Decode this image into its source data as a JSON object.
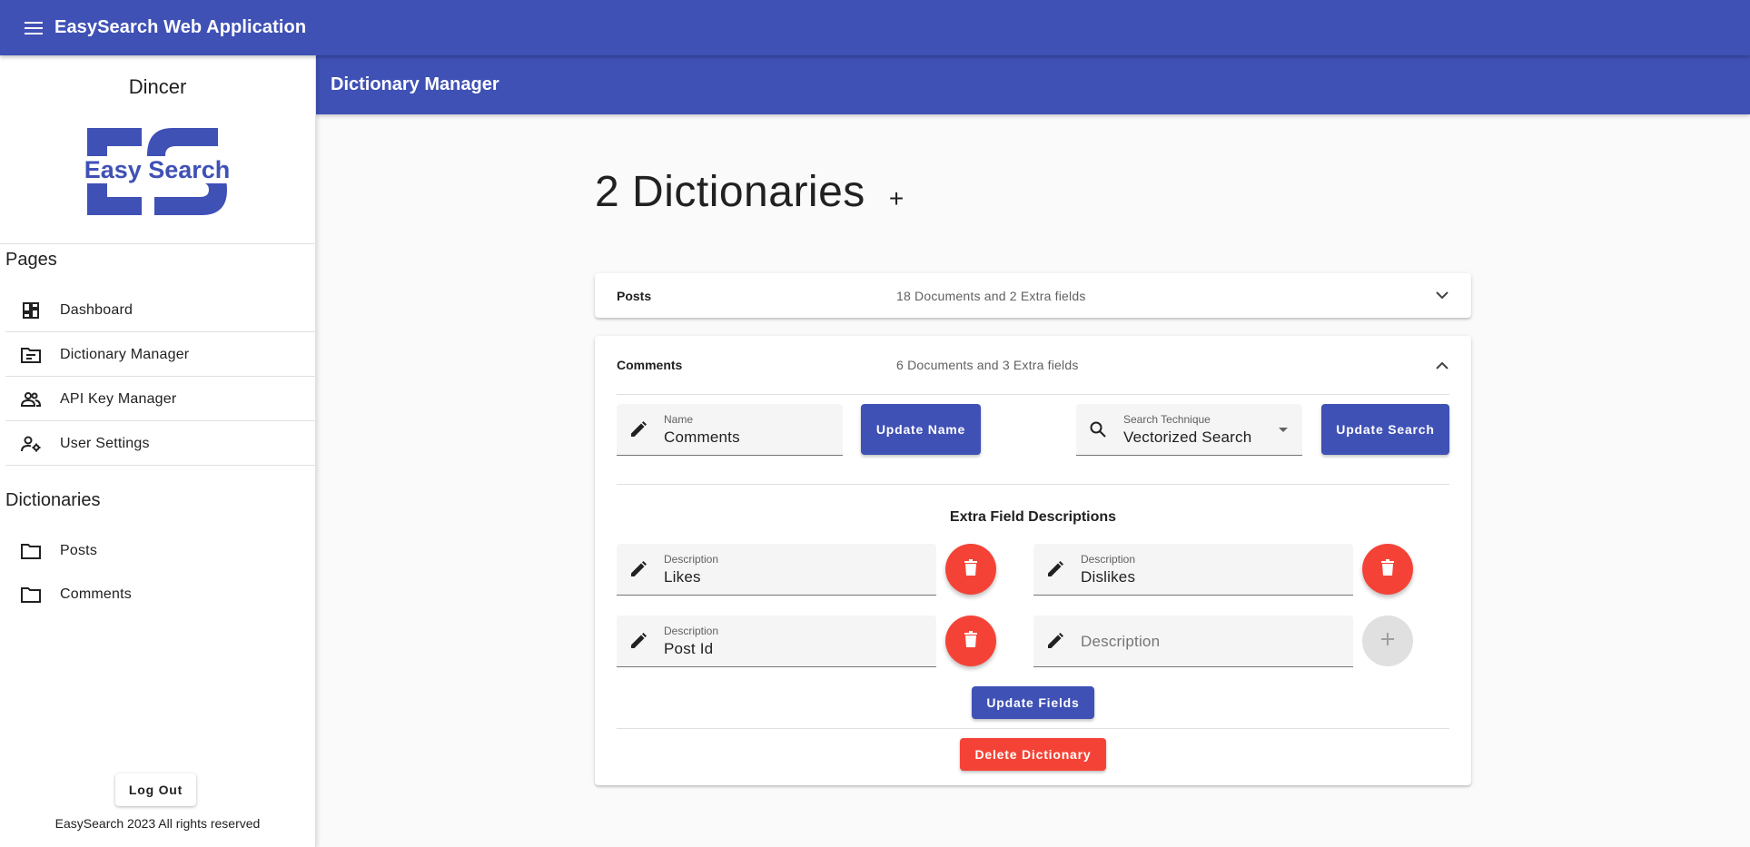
{
  "app": {
    "title": "EasySearch Web Application"
  },
  "sidebar": {
    "user_name": "Dincer",
    "logo_text": "Easy Search",
    "pages_title": "Pages",
    "pages": [
      {
        "label": "Dashboard",
        "icon": "dashboard-icon"
      },
      {
        "label": "Dictionary Manager",
        "icon": "folder-open-icon"
      },
      {
        "label": "API Key Manager",
        "icon": "people-icon"
      },
      {
        "label": "User Settings",
        "icon": "user-settings-icon"
      }
    ],
    "dictionaries_title": "Dictionaries",
    "dictionaries": [
      {
        "label": "Posts",
        "icon": "folder-icon"
      },
      {
        "label": "Comments",
        "icon": "folder-icon"
      }
    ],
    "logout_label": "Log Out",
    "footer": "EasySearch 2023 All rights reserved"
  },
  "subbar": {
    "title": "Dictionary Manager"
  },
  "main": {
    "heading": "2 Dictionaries",
    "add_symbol": "+",
    "panels": [
      {
        "name": "Posts",
        "meta": "18 Documents and 2 Extra fields",
        "expanded": false
      },
      {
        "name": "Comments",
        "meta": "6 Documents and 3 Extra fields",
        "expanded": true,
        "name_field": {
          "label": "Name",
          "value": "Comments"
        },
        "update_name_label": "Update Name",
        "search_field": {
          "label": "Search Technique",
          "value": "Vectorized Search"
        },
        "update_search_label": "Update Search",
        "extra_title": "Extra Field Descriptions",
        "extra_fields": [
          {
            "label": "Description",
            "value": "Likes"
          },
          {
            "label": "Description",
            "value": "Dislikes"
          },
          {
            "label": "Description",
            "value": "Post Id"
          }
        ],
        "new_field_placeholder": "Description",
        "update_fields_label": "Update Fields",
        "delete_label": "Delete Dictionary"
      }
    ]
  },
  "colors": {
    "primary": "#3f51b5",
    "danger": "#f44336",
    "background": "#fafafa"
  }
}
